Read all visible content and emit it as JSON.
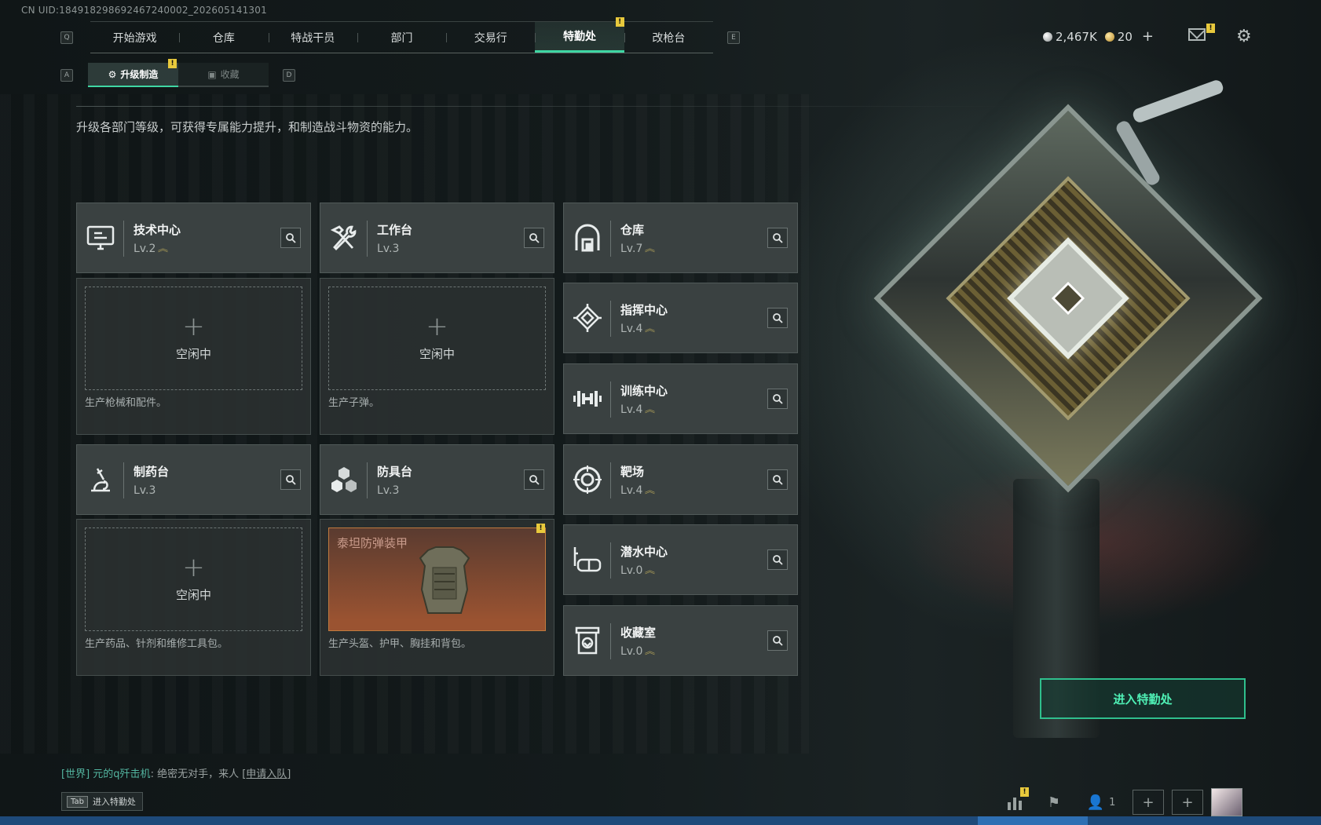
{
  "uid": "CN UID:18491829869246724000​2_202605141301",
  "nav": {
    "tabs": [
      {
        "label": "开始游戏",
        "active": false
      },
      {
        "label": "仓库",
        "active": false
      },
      {
        "label": "特战干员",
        "active": false
      },
      {
        "label": "部门",
        "active": false
      },
      {
        "label": "交易行",
        "active": false
      },
      {
        "label": "特勤处",
        "active": true
      },
      {
        "label": "改枪台",
        "active": false
      }
    ],
    "prev_key": "Q",
    "next_key": "E"
  },
  "currency": {
    "silver": "2,467K",
    "gold": "20",
    "plus": "+"
  },
  "sub_tabs": {
    "prev_key": "A",
    "next_key": "D",
    "items": [
      {
        "label": "升级制造",
        "active": true
      },
      {
        "label": "收藏",
        "active": false
      }
    ]
  },
  "description": "升级各部门等级，可获得专属能力提升，和制造战斗物资的能力。",
  "departments": [
    {
      "name": "技术中心",
      "level": "Lv.2",
      "icon": "computer-icon",
      "upgradable": true
    },
    {
      "name": "工作台",
      "level": "Lv.3",
      "icon": "hammer-wrench-icon",
      "upgradable": false
    },
    {
      "name": "仓库",
      "level": "Lv.7",
      "icon": "warehouse-icon",
      "upgradable": true
    },
    {
      "name": "指挥中心",
      "level": "Lv.4",
      "icon": "command-diamond-icon",
      "upgradable": true
    },
    {
      "name": "训练中心",
      "level": "Lv.4",
      "icon": "dumbbell-icon",
      "upgradable": true
    },
    {
      "name": "制药台",
      "level": "Lv.3",
      "icon": "microscope-icon",
      "upgradable": false
    },
    {
      "name": "防具台",
      "level": "Lv.3",
      "icon": "cubes-icon",
      "upgradable": false
    },
    {
      "name": "靶场",
      "level": "Lv.4",
      "icon": "target-icon",
      "upgradable": true
    },
    {
      "name": "潜水中心",
      "level": "Lv.0",
      "icon": "diving-mask-icon",
      "upgradable": true
    },
    {
      "name": "收藏室",
      "level": "Lv.0",
      "icon": "collection-room-icon",
      "upgradable": true
    }
  ],
  "production": {
    "tech": {
      "status": "空闲中",
      "desc": "生产枪械和配件。"
    },
    "workbench": {
      "status": "空闲中",
      "desc": "生产子弹。"
    },
    "pharmacy": {
      "status": "空闲中",
      "desc": "生产药品、针剂和维修工具包。"
    },
    "armor": {
      "item": "泰坦防弹装甲",
      "desc": "生产头盔、护甲、胸挂和背包。"
    }
  },
  "enter_button": "进入特勤处",
  "chat": {
    "channel": "[世界]",
    "user": "元的q歼击机",
    "message": ": 绝密无对手，来人",
    "link": "[申请入队]"
  },
  "tab_hint": {
    "key": "Tab",
    "label": "进入特勤处"
  },
  "bottom": {
    "team_count": "1"
  },
  "colors": {
    "accent": "#3fd6a3",
    "badge": "#e8c93c",
    "armor_slot": "#9a5331"
  }
}
